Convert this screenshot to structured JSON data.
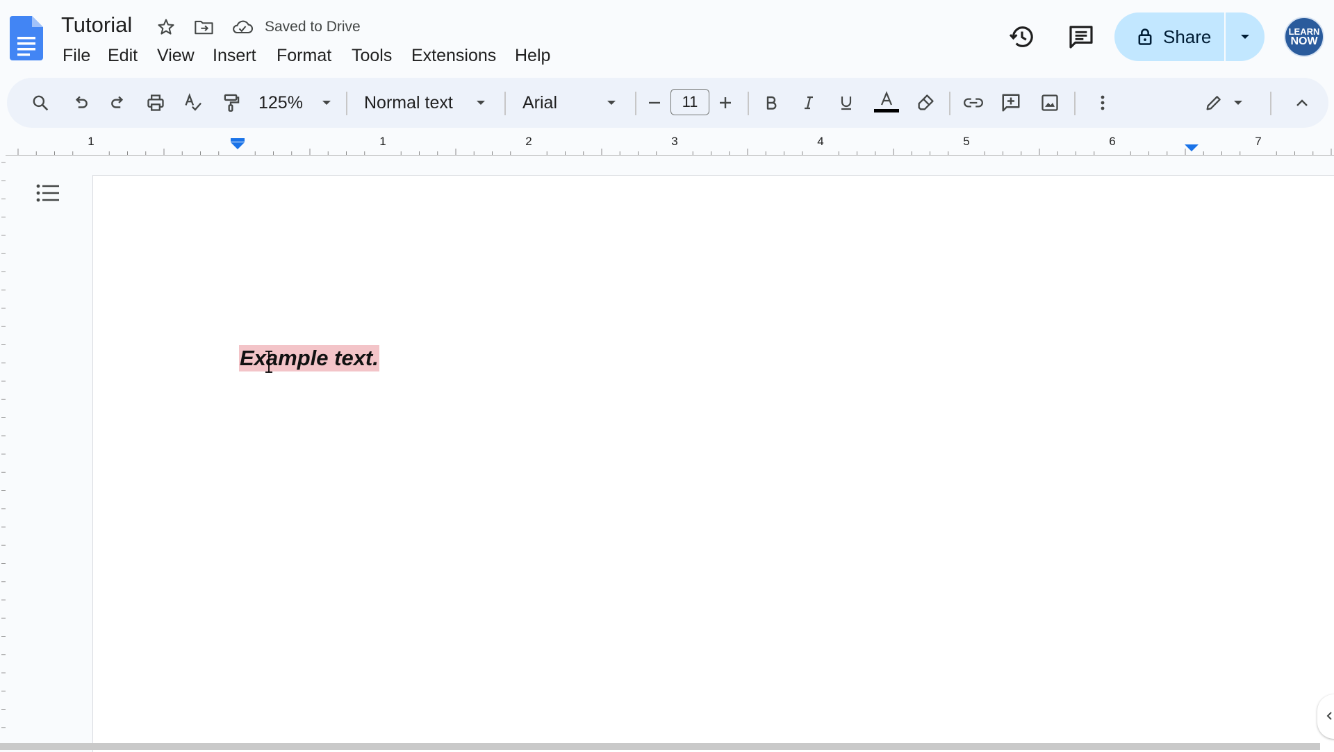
{
  "header": {
    "title": "Tutorial",
    "save_status": "Saved to Drive",
    "icons": [
      "docs-logo",
      "star-icon",
      "move-folder-icon",
      "cloud-icon",
      "history-icon",
      "comments-icon",
      "lock-icon",
      "chevron-down-icon"
    ],
    "share_label": "Share",
    "avatar_text_line1": "LEARN",
    "avatar_text_line2": "NOW"
  },
  "menu": {
    "items": [
      "File",
      "Edit",
      "View",
      "Insert",
      "Format",
      "Tools",
      "Extensions",
      "Help"
    ]
  },
  "toolbar": {
    "zoom": "125%",
    "style": "Normal text",
    "font": "Arial",
    "font_size": "11",
    "icons": [
      "search-icon",
      "undo-icon",
      "redo-icon",
      "print-icon",
      "spellcheck-icon",
      "paint-format-icon",
      "decrease-font-icon",
      "increase-font-icon",
      "bold-icon",
      "italic-icon",
      "underline-icon",
      "text-color-icon",
      "highlight-icon",
      "link-icon",
      "add-comment-icon",
      "image-icon",
      "more-icon",
      "editing-mode-icon",
      "collapse-icon"
    ]
  },
  "ruler": {
    "labels": [
      "1",
      "1",
      "2",
      "3",
      "4",
      "5",
      "6",
      "7"
    ]
  },
  "document": {
    "body_text": "Example text."
  },
  "colors": {
    "accent": "#0b57d0",
    "share_bg": "#c2e7ff",
    "highlight": "#f3c4c8",
    "toolbar_bg": "#edf2fa"
  }
}
